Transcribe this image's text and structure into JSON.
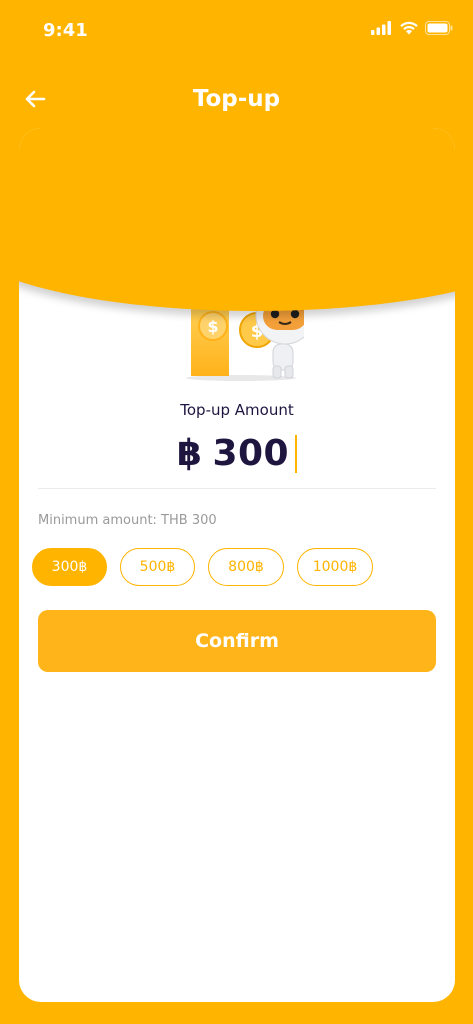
{
  "status_bar": {
    "time": "9:41"
  },
  "header": {
    "title": "Top-up",
    "back_icon": "arrow-left-icon"
  },
  "topup": {
    "amount_label": "Top-up Amount",
    "currency_symbol": "฿",
    "amount_value": "300",
    "min_amount_text": "Minimum amount: THB 300",
    "presets": [
      {
        "label": "300฿",
        "active": true
      },
      {
        "label": "500฿",
        "active": false
      },
      {
        "label": "800฿",
        "active": false
      },
      {
        "label": "1000฿",
        "active": false
      }
    ],
    "confirm_label": "Confirm"
  },
  "colors": {
    "primary": "#FFB400",
    "text_dark": "#1f1640",
    "muted": "#9a9a9a"
  }
}
